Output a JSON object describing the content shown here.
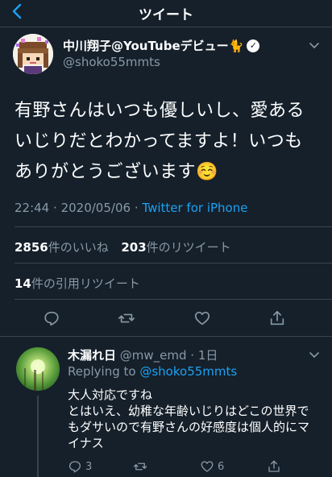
{
  "header": {
    "title": "ツイート"
  },
  "tweet": {
    "author_name": "中川翔子@YouTubeデビュー🐈",
    "author_handle": "@shoko55mmts",
    "lines": [
      "有野さんはいつも優しいし、愛ある",
      "いじりだとわかってますよ！いつも",
      "ありがとうございます☺️"
    ],
    "time": "22:44",
    "date": "2020/05/06",
    "separator": "·",
    "source": "Twitter for iPhone",
    "likes_count": "2856",
    "likes_label": "件のいいね",
    "retweets_count": "203",
    "retweets_label": "件のリツイート",
    "quotes_count": "14",
    "quotes_label": "件の引用リツイート"
  },
  "reply": {
    "name": "木漏れ日",
    "handle_time": "@mw_emd · 1日",
    "replying_prefix": "Replying to",
    "replying_to": "@shoko55mmts",
    "lines": [
      "大人対応ですね",
      "とはいえ、幼稚な年齢いじりはどこの世界で",
      "もダサいので有野さんの好感度は個人的にマ",
      "イナス"
    ],
    "reply_count": "3",
    "like_count": "6"
  },
  "colors": {
    "background": "#15202b",
    "accent": "#1da1f2",
    "secondary_text": "#8899a6",
    "divider": "#38444d"
  }
}
